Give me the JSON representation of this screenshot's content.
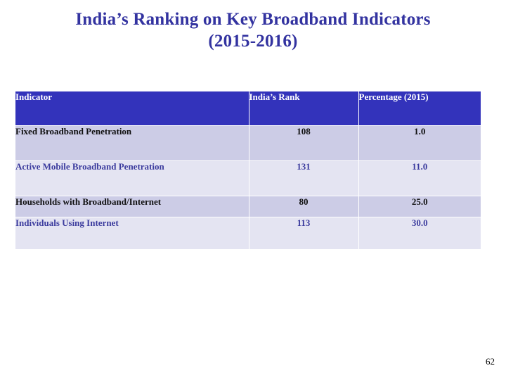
{
  "slide": {
    "title_line_1": "India’s Ranking on Key Broadband Indicators",
    "title_line_2": "(2015-2016)",
    "page_number": "62",
    "accent_header_color": "#3333bb",
    "title_color": "#3333a0",
    "row_odd_color": "#ccccE6",
    "row_even_color": "#e4e4f2"
  },
  "table": {
    "columns": [
      {
        "label": "Indicator"
      },
      {
        "label": "India’s Rank"
      },
      {
        "label": "Percentage (2015)"
      }
    ],
    "rows": [
      {
        "indicator": "Fixed Broadband Penetration",
        "rank": "108",
        "percentage": "1.0"
      },
      {
        "indicator": "Active Mobile Broadband Penetration",
        "rank": "131",
        "percentage": "11.0"
      },
      {
        "indicator": "Households with Broadband/Internet",
        "rank": "80",
        "percentage": "25.0"
      },
      {
        "indicator": "Individuals Using Internet",
        "rank": "113",
        "percentage": "30.0"
      }
    ]
  }
}
